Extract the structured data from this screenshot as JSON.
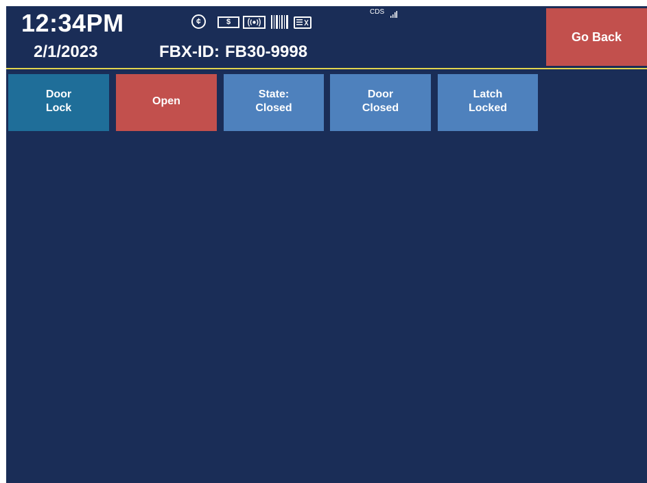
{
  "header": {
    "time": "12:34PM",
    "date": "2/1/2023",
    "fbx_label": "FBX-ID:",
    "fbx_value": "FB30-9998",
    "status_text": "CDS",
    "icons": [
      "coin-icon",
      "bill-icon",
      "nfc-icon",
      "barcode-icon",
      "card-reader-icon",
      "signal-icon"
    ],
    "coin_glyph": "¢",
    "bill_glyph": "$"
  },
  "go_back_label": "Go Back",
  "buttons": [
    {
      "label": "Door\nLock",
      "color": "#1f6e99"
    },
    {
      "label": "Open",
      "color": "#c2504d"
    },
    {
      "label": "State:\nClosed",
      "color": "#4e81bd"
    },
    {
      "label": "Door\nClosed",
      "color": "#4e81bd"
    },
    {
      "label": "Latch\nLocked",
      "color": "#4e81bd"
    }
  ],
  "colors": {
    "background": "#1a2d57",
    "accent_line": "#e3d64e",
    "go_back": "#c2504d"
  }
}
